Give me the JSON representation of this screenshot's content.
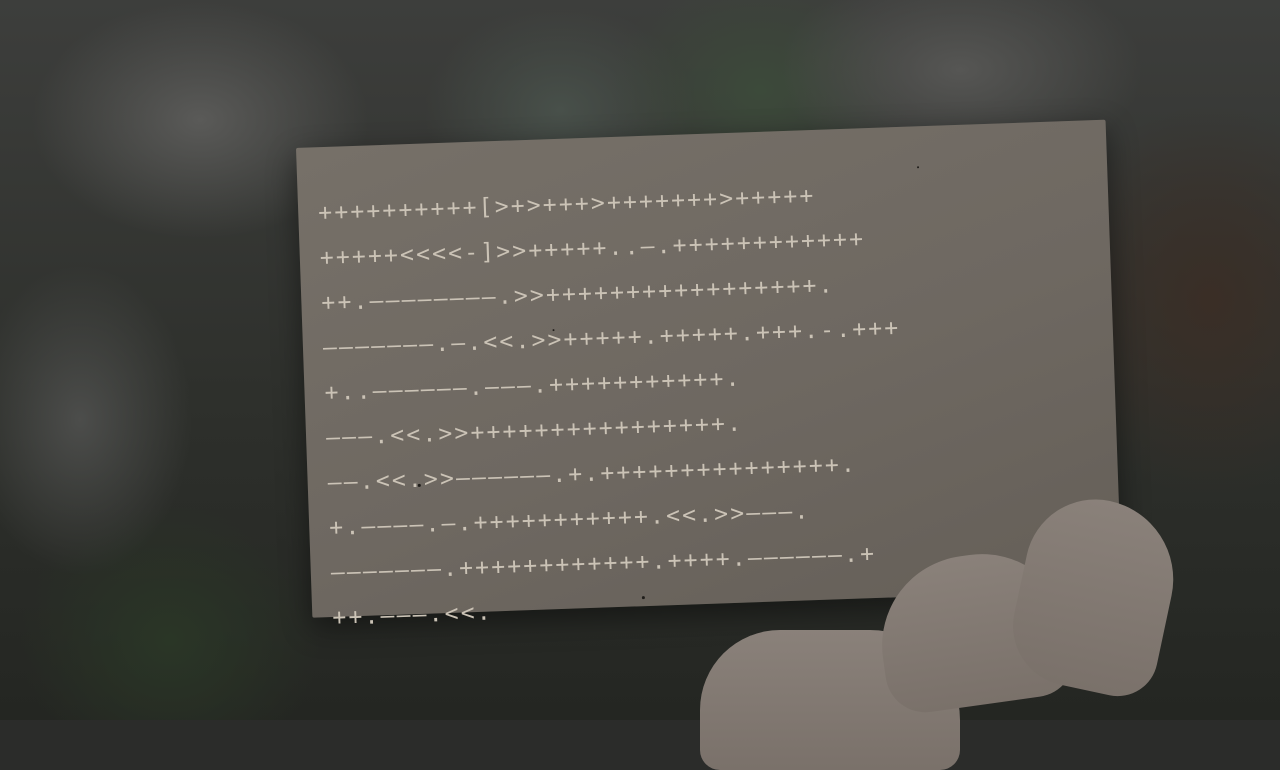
{
  "card": {
    "lines": [
      "++++++++++[>+>+++>+++++++>+++++",
      "+++++<<<<-]>>+++++..—.++++++++++++",
      "++.————————.>>+++++++++++++++++.",
      "———————.—.<<.>>+++++.+++++.+++.-.+++",
      "+..——————.———.+++++++++++.",
      "———.<<.>>++++++++++++++++.",
      "——.<<.>>——————.+.+++++++++++++++.",
      "+.————.—.+++++++++++.<<.>>———.",
      "———————.++++++++++++.++++.——————.+",
      "++.———.<<."
    ]
  }
}
